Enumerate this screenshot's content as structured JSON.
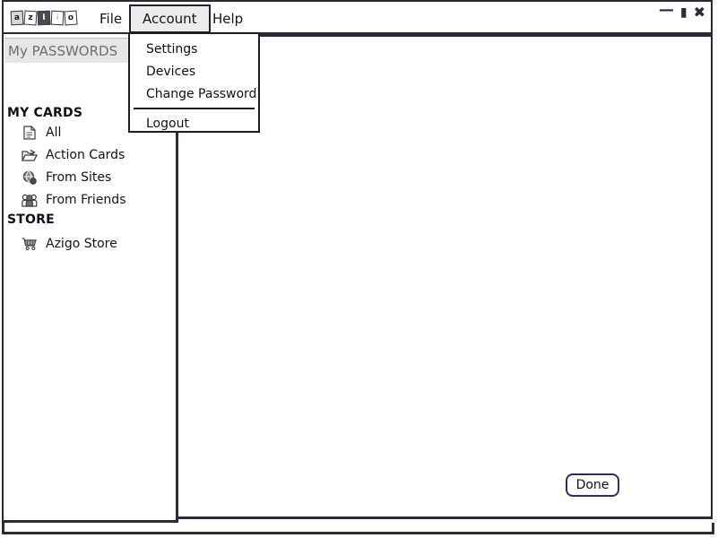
{
  "window": {
    "brand_logo_letters": [
      "a",
      "z",
      "I",
      "i",
      "o"
    ],
    "controls": {
      "minimize": "—",
      "maximize": "▮",
      "close": "✖"
    }
  },
  "menubar": {
    "items": [
      {
        "label": "File",
        "active": false
      },
      {
        "label": "Account",
        "active": true
      },
      {
        "label": "Help",
        "active": false
      }
    ]
  },
  "account_menu": {
    "items": [
      {
        "label": "Settings"
      },
      {
        "label": "Devices"
      },
      {
        "label": "Change Password"
      },
      {
        "label": "Logout"
      }
    ]
  },
  "sidebar": {
    "header": "My PASSWORDS",
    "groups": [
      {
        "title": "MY CARDS",
        "items": [
          {
            "label": "All",
            "icon": "document-icon"
          },
          {
            "label": "Action Cards",
            "icon": "folder-open-icon"
          },
          {
            "label": "From Sites",
            "icon": "globe-icon"
          },
          {
            "label": "From Friends",
            "icon": "people-icon"
          }
        ]
      },
      {
        "title": "STORE",
        "items": [
          {
            "label": "Azigo Store",
            "icon": "shopping-cart-icon"
          }
        ]
      }
    ]
  },
  "main": {
    "done_label": "Done"
  },
  "colors": {
    "frame": "#2b2b33",
    "menu_active_bg": "#ececec",
    "sidebar_header_bg": "#e6e6e6",
    "sidebar_header_text": "#6f6f6f",
    "done_border": "#332a5e"
  }
}
